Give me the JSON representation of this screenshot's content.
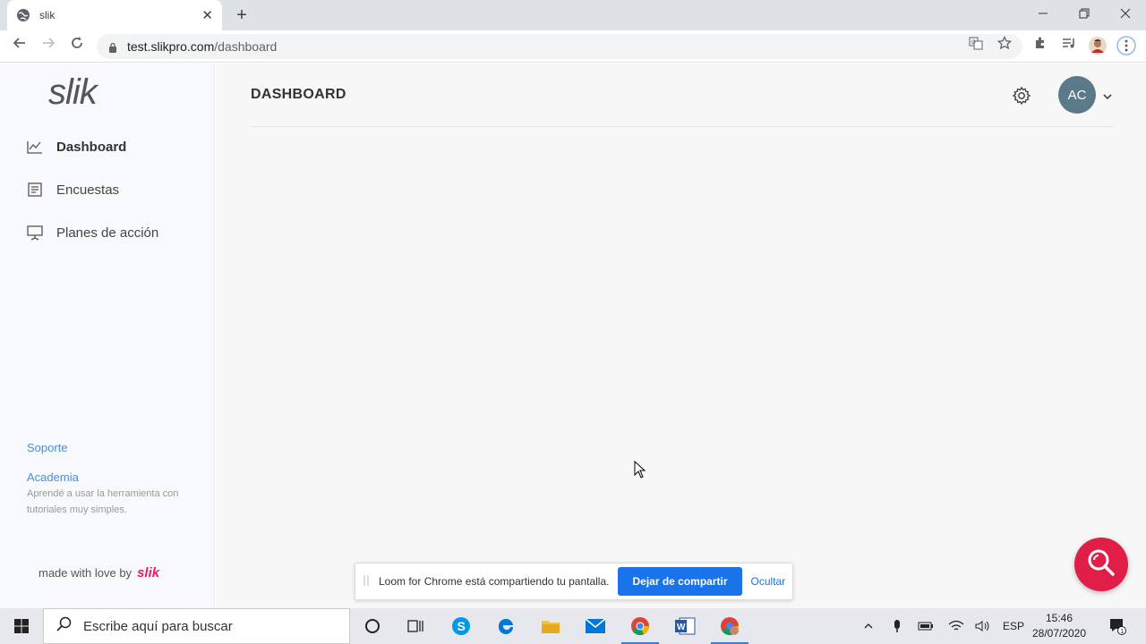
{
  "browser": {
    "tab_title": "slik",
    "tab_close": "✕",
    "new_tab": "+",
    "url_host": "test.slikpro.com",
    "url_path": "/dashboard"
  },
  "sidebar": {
    "logo": "slik",
    "items": [
      {
        "label": "Dashboard",
        "icon": "trend-chart-icon",
        "active": true
      },
      {
        "label": "Encuestas",
        "icon": "document-list-icon",
        "active": false
      },
      {
        "label": "Planes de acción",
        "icon": "presentation-board-icon",
        "active": false
      }
    ],
    "support": "Soporte",
    "academy": "Academia",
    "academy_desc": "Aprendé a usar la herramienta con tutoriales muy simples.",
    "made_with": "made with love by",
    "made_with_logo": "slik"
  },
  "main": {
    "title": "DASHBOARD",
    "avatar_initials": "AC"
  },
  "loom": {
    "message": "Loom for Chrome está compartiendo tu pantalla.",
    "stop_label": "Dejar de compartir",
    "hide_label": "Ocultar"
  },
  "taskbar": {
    "search_placeholder": "Escribe aquí para buscar",
    "language": "ESP",
    "time": "15:46",
    "date": "28/07/2020",
    "notification_count": "1"
  },
  "colors": {
    "accent": "#e01e48",
    "avatar": "#5a7a8a",
    "link": "#4a90d9",
    "loom_button": "#1a73e8"
  }
}
